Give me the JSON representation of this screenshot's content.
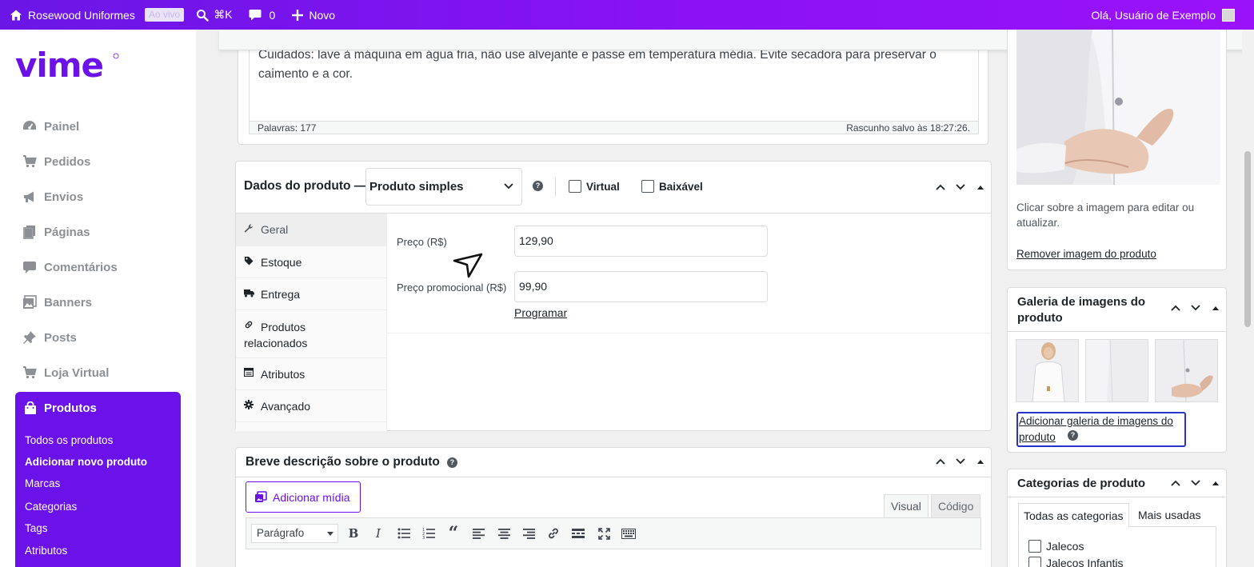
{
  "topbar": {
    "site_name": "Rosewood Uniformes",
    "live_badge": "Ao vivo",
    "search_shortcut": "⌘K",
    "comments_count": "0",
    "new_label": "Novo",
    "greeting": "Olá, Usuário de Exemplo",
    "bar_color": "#7a14ef"
  },
  "sidebar": {
    "logo_text": "vime",
    "menu": [
      {
        "label": "Painel",
        "icon": "dashboard-icon"
      },
      {
        "label": "Pedidos",
        "icon": "cart-icon"
      },
      {
        "label": "Envios",
        "icon": "megaphone-icon"
      },
      {
        "label": "Páginas",
        "icon": "pages-icon"
      },
      {
        "label": "Comentários",
        "icon": "comment-icon"
      },
      {
        "label": "Banners",
        "icon": "image-icon"
      },
      {
        "label": "Posts",
        "icon": "pin-icon"
      },
      {
        "label": "Loja Virtual",
        "icon": "cart-icon"
      }
    ],
    "active": {
      "label": "Produtos",
      "icon": "bag-icon",
      "accent": "#6b12e8",
      "submenu": [
        "Todos os produtos",
        "Adicionar novo produto",
        "Marcas",
        "Categorias",
        "Tags",
        "Atributos"
      ],
      "current_index": 1
    }
  },
  "editor": {
    "content": "Cuidados: lave à máquina em água fria, não use alvejante e passe em temperatura média. Evite secadora para preservar o caimento e a cor.",
    "word_count": "Palavras: 177",
    "draft_saved": "Rascunho salvo às 18:27:26."
  },
  "product_data": {
    "title": "Dados do produto —",
    "type_value": "Produto simples",
    "virtual_label": "Virtual",
    "virtual_checked": false,
    "downloadable_label": "Baixável",
    "downloadable_checked": false,
    "tabs": [
      {
        "label": "Geral",
        "icon": "wrench-icon"
      },
      {
        "label": "Estoque",
        "icon": "tag-icon"
      },
      {
        "label": "Entrega",
        "icon": "truck-icon"
      },
      {
        "label": "Produtos relacionados",
        "icon": "link-icon"
      },
      {
        "label": "Atributos",
        "icon": "list-icon"
      },
      {
        "label": "Avançado",
        "icon": "gear-icon"
      }
    ],
    "active_tab": "Geral",
    "regular_price_label": "Preço (R$)",
    "regular_price": "129,90",
    "sale_price_label": "Preço promocional (R$)",
    "sale_price": "99,90",
    "schedule_link": "Programar"
  },
  "short_description": {
    "title": "Breve descrição sobre o produto",
    "add_media": "Adicionar mídia",
    "tab_visual": "Visual",
    "tab_code": "Código",
    "format_value": "Parágrafo"
  },
  "featured_image": {
    "hint": "Clicar sobre a imagem para editar ou atualizar.",
    "remove_link": "Remover imagem do produto"
  },
  "gallery": {
    "title": "Galeria de imagens do produto",
    "add_link": "Adicionar galeria de imagens do produto"
  },
  "categories": {
    "title": "Categorias de produto",
    "tab_all": "Todas as categorias",
    "tab_most_used": "Mais usadas",
    "items": [
      {
        "label": "Jalecos",
        "checked": false
      },
      {
        "label": "Jalecos Infantis",
        "checked": false
      }
    ]
  }
}
